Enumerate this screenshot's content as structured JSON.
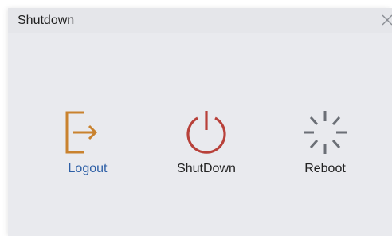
{
  "dialog": {
    "title": "Shutdown",
    "close_icon": "close-icon"
  },
  "actions": [
    {
      "label": "Logout",
      "icon": "logout-icon",
      "color": "#c9822e",
      "label_color": "#2d5fa6"
    },
    {
      "label": "ShutDown",
      "icon": "power-icon",
      "color": "#b8413a",
      "label_color": "#222222"
    },
    {
      "label": "Reboot",
      "icon": "reboot-spinner-icon",
      "color": "#6b6f76",
      "label_color": "#222222"
    }
  ]
}
